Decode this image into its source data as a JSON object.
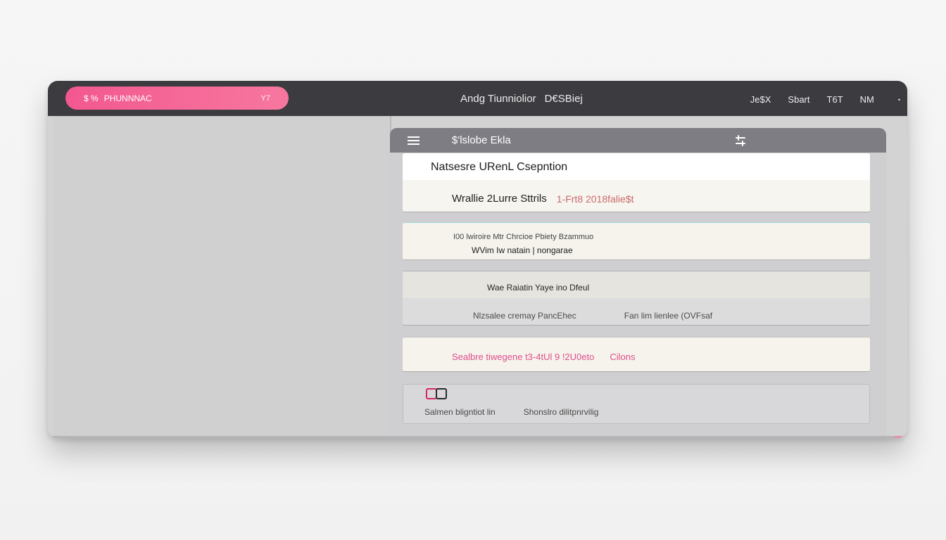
{
  "titlebar": {
    "search_pill": {
      "prefix": "$ %",
      "text": "PHUNNNAC",
      "code": "Y7"
    },
    "title": [
      "Andg Tiunniolior",
      "D€SBiej"
    ],
    "right_items": [
      "Je$X",
      "Sbart",
      "T6T",
      "NM",
      "•"
    ]
  },
  "panel": {
    "header_title": "$'lslobe Ekla",
    "card1": {
      "heading": "Natsesre URenL Csepntion",
      "row_label": "Wrallie 2Lurre Sttrils",
      "row_accent": "1-Frt8 2018falie$t"
    },
    "card2": {
      "line1": "I00 lwiroire Mtr Chrcioe Pbiety Bzammuo",
      "line2": "WVim Iw natain | nongarae"
    },
    "card3": {
      "heading": "Wae Raiatin Yaye ino Dfeul",
      "col1": "Nlzsalee cremay PancEhec",
      "col2": "Fan lim lienlee (OVFsaf"
    },
    "card4": {
      "text": "Sealbre tiwegene t3-4tUl 9 !2U0eto",
      "extra": "Cilons"
    },
    "card5": {
      "col1": "Salmen bligntiot lin",
      "col2": "Shonslro dilitpnrvilig"
    }
  },
  "colors": {
    "accent_pink": "#f2588f",
    "titlebar": "#3b3b40",
    "panel_header": "#7d7d83"
  },
  "icons": [
    "menu-icon",
    "settings-icon",
    "book-icon"
  ]
}
